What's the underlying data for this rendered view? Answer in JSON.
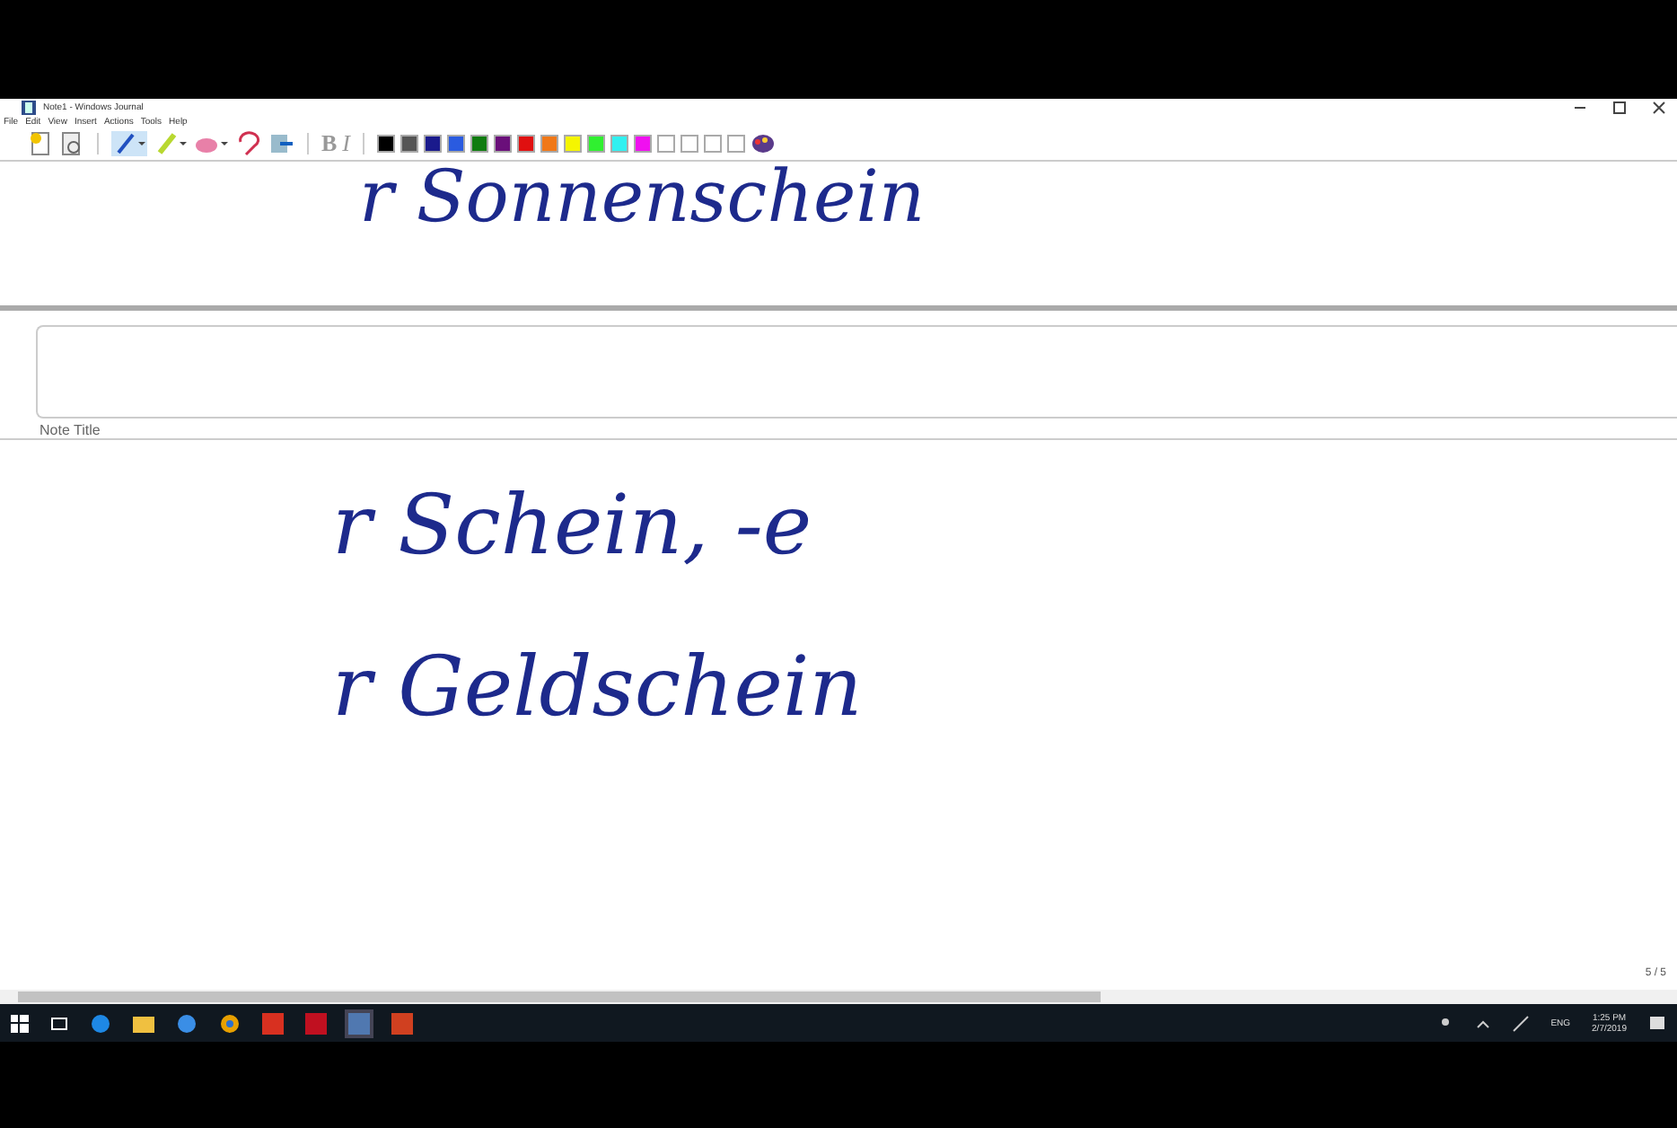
{
  "window": {
    "title": "Note1 - Windows Journal"
  },
  "menu": [
    "File",
    "Edit",
    "View",
    "Insert",
    "Actions",
    "Tools",
    "Help"
  ],
  "toolbar": {
    "bold": "B",
    "italic": "I",
    "colors": [
      {
        "color": "#000000",
        "selected": false
      },
      {
        "color": "#555555",
        "selected": false
      },
      {
        "color": "#1a1a8c",
        "selected": false
      },
      {
        "color": "#2a5be0",
        "selected": false
      },
      {
        "color": "#107c10",
        "selected": false
      },
      {
        "color": "#6a0f7a",
        "selected": false
      },
      {
        "color": "#e01010",
        "selected": false
      },
      {
        "color": "#f07818",
        "selected": false
      },
      {
        "color": "#f5f500",
        "selected": false
      },
      {
        "color": "#30f030",
        "selected": false
      },
      {
        "color": "#30f0f0",
        "selected": false
      },
      {
        "color": "#f010f0",
        "selected": false
      },
      {
        "color": "#ffffff",
        "selected": false
      },
      {
        "color": "#ffffff",
        "selected": false
      },
      {
        "color": "#ffffff",
        "selected": false
      },
      {
        "color": "#ffffff",
        "selected": false
      }
    ]
  },
  "page_top": {
    "ink": "r Sonnenschein"
  },
  "note_title": {
    "label": "Note Title"
  },
  "ink_lines": [
    "r Schein, -e",
    "r Geldschein"
  ],
  "page_number": "5 / 5",
  "taskbar": {
    "language": "ENG",
    "time": "1:25 PM",
    "date": "2/7/2019"
  }
}
